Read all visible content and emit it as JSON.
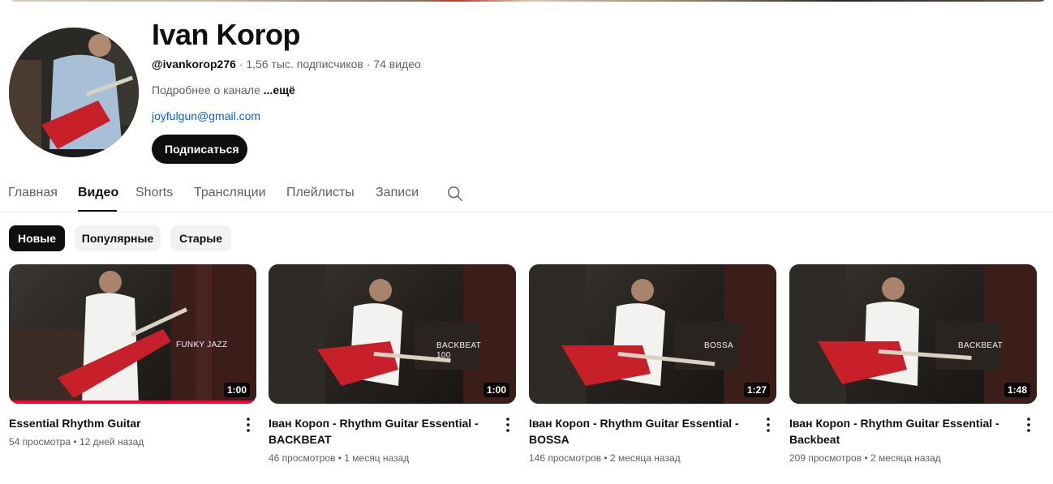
{
  "channel": {
    "name": "Ivan Korop",
    "handle": "@ivankorop276",
    "subscribers": "1,56 тыс. подписчиков",
    "video_count": "74 видео",
    "about_prefix": "Подробнее о канале",
    "about_more": "...ещё",
    "email": "joyfulgun@gmail.com",
    "subscribe_label": "Подписаться"
  },
  "tabs": [
    "Главная",
    "Видео",
    "Shorts",
    "Трансляции",
    "Плейлисты",
    "Записи"
  ],
  "chips": [
    "Новые",
    "Популярные",
    "Старые"
  ],
  "videos": [
    {
      "title": "Essential Rhythm Guitar",
      "views": "54 просмотра",
      "age": "12 дней назад",
      "duration": "1:00",
      "overlay": "FUNKY JAZZ",
      "watched_fraction": 1.0
    },
    {
      "title": "Іван Короп - Rhythm Guitar Essential - BACKBEAT",
      "views": "46 просмотров",
      "age": "1 месяц назад",
      "duration": "1:00",
      "overlay": "BACKBEAT",
      "overlay2": "100"
    },
    {
      "title": "Іван Короп - Rhythm Guitar Essential - BOSSA",
      "views": "146 просмотров",
      "age": "2 месяца назад",
      "duration": "1:27",
      "overlay": "BOSSA"
    },
    {
      "title": "Іван Короп - Rhythm Guitar Essential - Backbeat",
      "views": "209 просмотров",
      "age": "2 месяца назад",
      "duration": "1:48",
      "overlay": "BACKBEAT"
    }
  ],
  "meta_separator": "•",
  "colors": {
    "accent": "#ff0033",
    "link": "#065fd4",
    "text_secondary": "#606060"
  }
}
